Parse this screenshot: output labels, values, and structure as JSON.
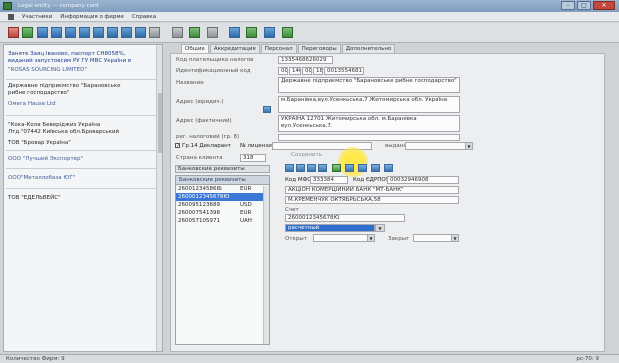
{
  "window": {
    "title": "Legal entity — company card",
    "minimize": "–",
    "maximize": "□",
    "close": "✕"
  },
  "menu": {
    "items": [
      "Участники",
      "Информация о фирме",
      "Справка"
    ]
  },
  "toolbar": {
    "icons": [
      "save-icon",
      "print-icon",
      "first-icon",
      "prev-icon",
      "next-icon",
      "last-icon",
      "add-icon",
      "edit-icon",
      "delete-icon",
      "list-icon",
      "refresh-icon",
      "filter-icon",
      "settings-icon",
      "help-icon",
      "export-icon",
      "exit-icon"
    ]
  },
  "left_list": {
    "items": [
      {
        "lines": [
          "Заняте Заяц Іваново, паспорт СН8058%,",
          "виданий запустовсим РУ ГУ МВС України в"
        ],
        "selected": true
      },
      {
        "lines": [
          "\"ROSAS SOURCING LIMITED\""
        ],
        "selected": false
      },
      {
        "lines": [
          "Державне підприємство \"Барановське",
          "рибне господарство\""
        ],
        "selected": false
      },
      {
        "lines": [
          "Омега Hause Ltd"
        ],
        "selected": false
      },
      {
        "lines": [
          "\"Кока-Кола Беверіджиз Україна",
          "Лтд.\"07442 Київська обл.Броварський"
        ],
        "selected": false
      },
      {
        "lines": [
          "ТОВ \"Бровар Україна\""
        ],
        "selected": false
      },
      {
        "lines": [
          "ООО \"Лучший Экспортер\""
        ],
        "selected": false
      },
      {
        "lines": [
          "ООО\"Металлобаза ЮГ\""
        ],
        "selected": false
      },
      {
        "lines": [
          "ТОВ \"ЕДЕЛЬВЕЙС\""
        ],
        "selected": false
      }
    ]
  },
  "tabs": [
    "Общие",
    "Аккредитация",
    "Персонал",
    "Переговоры",
    "Дополнительно"
  ],
  "form": {
    "tax_code_label": "Код платильщика налогов",
    "tax_code_value": "1335468626029",
    "ident_label": "Идентификационный код",
    "ident_parts": [
      "00",
      "140",
      "00",
      "18",
      "0013554681"
    ],
    "name_label": "Название",
    "name_value": "Державне підприємство \"Барановське рибне господарство\"",
    "legal_address_label": "Адрес (юридич.)",
    "legal_address_value": "м.Баранівка,вул.Усенкьська,7 Житомирська обл. Україна",
    "actual_address_label": "Адрес (фактичний)",
    "actual_address_value": "УКРАЇНА 12701 Житомирська обл. м.Баранівка вул.Усенкьська,7.",
    "tax_reg_label": "рег. налоговий (гр. 8)",
    "declarant_label": "Гр.14 Декларант",
    "license_label": "№ лицензии",
    "issued_label": "выдана",
    "client_code_label": "Страна клиента",
    "client_code_value": "318",
    "bank_accounts_label": "Банковские реквизиты",
    "saved_label": "Сохранить",
    "mfo_label": "Код МФО",
    "mfo_value": "333384",
    "edrpou_label": "Код ЄДРПОУ",
    "edrpou_value": "00032946908",
    "bank_name_value": "АКЦІОН КОМЕРЦІЙНИЙ БАНК \"МТ-БАНК\"",
    "bank_address_value": "М.КРЕМЕНЧУК ОКТЯБРЬСЬКА,58",
    "account_label": "Счет",
    "account_value": "2600012345678Ю",
    "account_type_value": "расчетный",
    "opened_label": "Открыт",
    "closed_label": "Закрыт"
  },
  "accounts": {
    "header": "Банковские реквизиты",
    "rows": [
      {
        "num": "26001234586ІБ",
        "cur": "EUR",
        "selected": false
      },
      {
        "num": "2600012345678Ю",
        "cur": "",
        "selected": true
      },
      {
        "num": "260095123689",
        "cur": "USD",
        "selected": false
      },
      {
        "num": "260007541398",
        "cur": "EUR",
        "selected": false
      },
      {
        "num": "260057105971",
        "cur": "UAH",
        "selected": false
      }
    ]
  },
  "status": {
    "left": "Количество Фирм: 9",
    "right": "рс-70: 9"
  },
  "colors": {
    "selection": "#3a78d6",
    "highlight": "#ffe94a"
  }
}
